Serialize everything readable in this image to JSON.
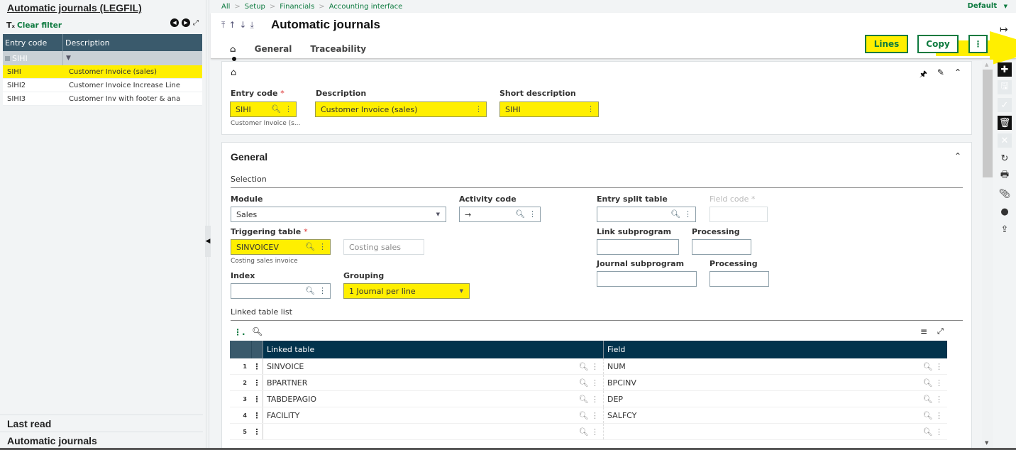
{
  "left_panel": {
    "title": "Automatic journals (LEGFIL)",
    "clear_filter": "Clear filter",
    "columns": [
      "Entry code",
      "Description"
    ],
    "filter_value": "SIHI",
    "rows": [
      {
        "code": "SIHI",
        "description": "Customer Invoice (sales)",
        "selected": true
      },
      {
        "code": "SIHI2",
        "description": "Customer Invoice Increase Line",
        "selected": false
      },
      {
        "code": "SIHI3",
        "description": "Customer Inv with footer & ana",
        "selected": false
      }
    ],
    "last_read": "Last read",
    "bottom_item": "Automatic journals"
  },
  "breadcrumb": [
    "All",
    "Setup",
    "Financials",
    "Accounting interface"
  ],
  "default_label": "Default",
  "header": {
    "title": "Automatic journals",
    "tabs": [
      "General",
      "Traceability"
    ],
    "buttons": {
      "lines": "Lines",
      "copy": "Copy"
    },
    "highlight_color": "#ffef00",
    "accent_color": "#0d7a3f"
  },
  "top_card": {
    "entry_code_label": "Entry code",
    "entry_code": "SIHI",
    "entry_code_hint": "Customer Invoice (s...",
    "description_label": "Description",
    "description": "Customer Invoice (sales)",
    "short_description_label": "Short description",
    "short_description": "SIHI"
  },
  "general": {
    "title": "General",
    "selection_label": "Selection",
    "module_label": "Module",
    "module": "Sales",
    "activity_code_label": "Activity code",
    "activity_code": "→",
    "entry_split_table_label": "Entry split table",
    "field_code_label": "Field code",
    "triggering_table_label": "Triggering table",
    "triggering_table": "SINVOICEV",
    "triggering_table_desc": "Costing sales",
    "triggering_table_hint": "Costing sales invoice",
    "link_subprogram_label": "Link subprogram",
    "processing_label": "Processing",
    "journal_subprogram_label": "Journal subprogram",
    "index_label": "Index",
    "grouping_label": "Grouping",
    "grouping": "1 Journal per line",
    "linked_table_list_label": "Linked table list"
  },
  "grid": {
    "columns": [
      "Linked table",
      "Field"
    ],
    "rows": [
      {
        "num": "1",
        "table": "SINVOICE",
        "field": "NUM"
      },
      {
        "num": "2",
        "table": "BPARTNER",
        "field": "BPCINV"
      },
      {
        "num": "3",
        "table": "TABDEPAGIO",
        "field": "DEP"
      },
      {
        "num": "4",
        "table": "FACILITY",
        "field": "SALFCY"
      },
      {
        "num": "5",
        "table": "",
        "field": ""
      }
    ]
  }
}
